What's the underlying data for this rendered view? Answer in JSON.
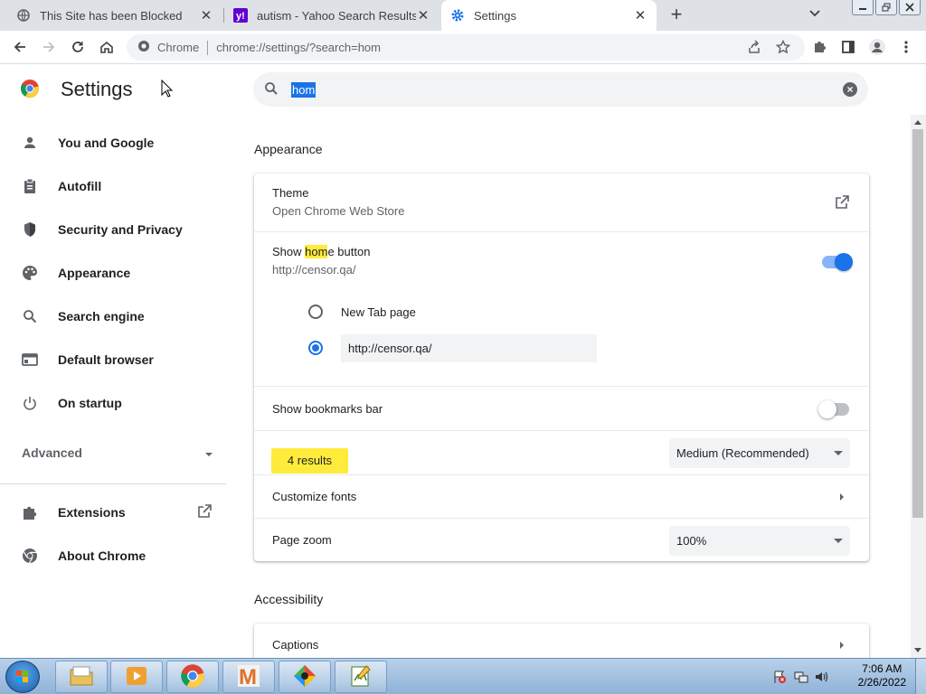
{
  "tabs": [
    {
      "title": "This Site has been Blocked",
      "icon": "globe-icon",
      "active": false
    },
    {
      "title": "autism - Yahoo Search Results Im",
      "icon": "yahoo-icon",
      "active": false
    },
    {
      "title": "Settings",
      "icon": "gear-icon",
      "active": true
    }
  ],
  "toolbar": {
    "site_label": "Chrome",
    "url": "chrome://settings/?search=hom"
  },
  "sidebar": {
    "title": "Settings",
    "items": [
      {
        "label": "You and Google",
        "icon": "person-icon"
      },
      {
        "label": "Autofill",
        "icon": "clipboard-icon"
      },
      {
        "label": "Security and Privacy",
        "icon": "shield-icon"
      },
      {
        "label": "Appearance",
        "icon": "palette-icon"
      },
      {
        "label": "Search engine",
        "icon": "search-icon"
      },
      {
        "label": "Default browser",
        "icon": "browser-icon"
      },
      {
        "label": "On startup",
        "icon": "power-icon"
      }
    ],
    "advanced_label": "Advanced",
    "extensions_label": "Extensions",
    "about_label": "About Chrome"
  },
  "search": {
    "query": "hom"
  },
  "appearance": {
    "section_title": "Appearance",
    "theme_label": "Theme",
    "theme_sub": "Open Chrome Web Store",
    "home_button_prefix": "Show ",
    "home_button_highlight": "hom",
    "home_button_suffix": "e button",
    "home_button_sub": "http://censor.qa/",
    "home_button_enabled": true,
    "new_tab_label": "New Tab page",
    "custom_url": "http://censor.qa/",
    "bookmarks_label": "Show bookmarks bar",
    "bookmarks_enabled": false,
    "font_size_value": "Medium (Recommended)",
    "results_bubble": "4 results",
    "customize_fonts_label": "Customize fonts",
    "page_zoom_label": "Page zoom",
    "page_zoom_value": "100%"
  },
  "accessibility": {
    "section_title": "Accessibility",
    "captions_label": "Captions"
  },
  "taskbar": {
    "time": "7:06 AM",
    "date": "2/26/2022"
  },
  "colors": {
    "accent": "#1a73e8",
    "highlight": "#ffeb3b"
  }
}
